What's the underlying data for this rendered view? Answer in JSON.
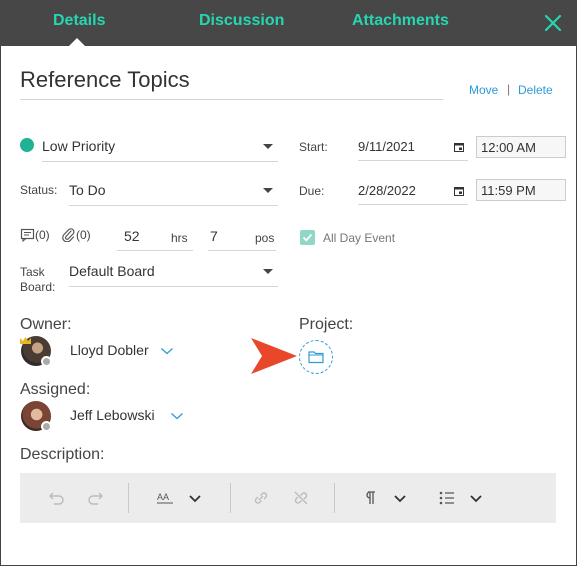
{
  "tabs": [
    {
      "label": "Details"
    },
    {
      "label": "Discussion"
    },
    {
      "label": "Attachments"
    }
  ],
  "title": "Reference Topics",
  "actions": {
    "move": "Move",
    "separator": "|",
    "delete": "Delete"
  },
  "priority": {
    "value": "Low Priority",
    "color": "#1fb393"
  },
  "status": {
    "label": "Status:",
    "value": "To Do"
  },
  "start": {
    "label": "Start:",
    "date": "9/11/2021",
    "time": "12:00 AM"
  },
  "due": {
    "label": "Due:",
    "date": "2/28/2022",
    "time": "11:59 PM"
  },
  "counts": {
    "notes": "(0)",
    "attachments": "(0)"
  },
  "hours": {
    "value": "52",
    "unit": "hrs"
  },
  "pos": {
    "value": "7",
    "unit": "pos"
  },
  "all_day": {
    "label": "All Day Event",
    "checked": true
  },
  "task_board": {
    "label_line1": "Task",
    "label_line2": "Board:",
    "value": "Default Board"
  },
  "owner": {
    "label": "Owner:",
    "name": "Lloyd Dobler"
  },
  "project": {
    "label": "Project:"
  },
  "assigned": {
    "label": "Assigned:",
    "name": "Jeff Lebowski"
  },
  "description": {
    "label": "Description:"
  },
  "toolbar_icons": [
    "undo-icon",
    "redo-icon",
    "font-size-icon",
    "link-icon",
    "unlink-icon",
    "paragraph-icon",
    "list-icon"
  ],
  "colors": {
    "accent": "#27d6b0",
    "link": "#2c9cd6",
    "header_bg": "#474747",
    "arrow": "#e8472a"
  }
}
